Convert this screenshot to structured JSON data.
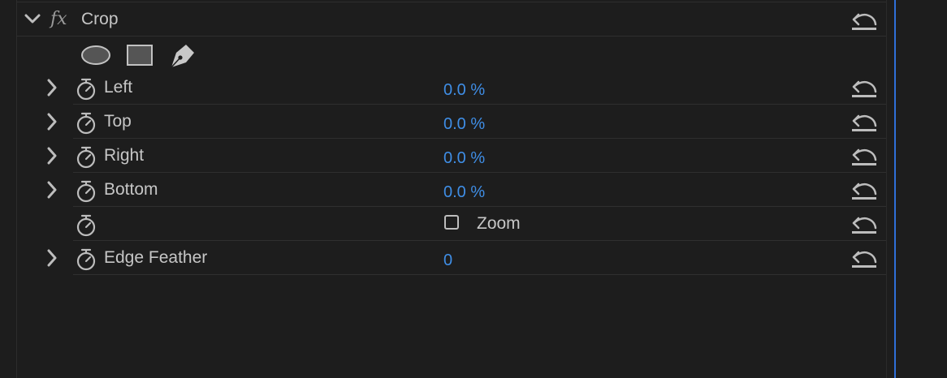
{
  "effect": {
    "name": "Crop",
    "fx_label": "fx",
    "expanded": true
  },
  "mask_tools": [
    {
      "name": "ellipse-mask-tool",
      "icon": "ellipse-icon"
    },
    {
      "name": "rectangle-mask-tool",
      "icon": "rectangle-icon"
    },
    {
      "name": "pen-mask-tool",
      "icon": "pen-icon"
    }
  ],
  "properties": [
    {
      "label": "Left",
      "value": "0.0 %",
      "expandable": true
    },
    {
      "label": "Top",
      "value": "0.0 %",
      "expandable": true
    },
    {
      "label": "Right",
      "value": "0.0 %",
      "expandable": true
    },
    {
      "label": "Bottom",
      "value": "0.0 %",
      "expandable": true
    },
    {
      "label": "",
      "checkbox_label": "Zoom",
      "checked": false,
      "expandable": false
    },
    {
      "label": "Edge Feather",
      "value": "0",
      "expandable": true
    }
  ],
  "colors": {
    "background": "#1d1d1d",
    "value_blue": "#3f8ee6",
    "text": "#c6c6c6",
    "playhead": "#2f6fd8"
  }
}
